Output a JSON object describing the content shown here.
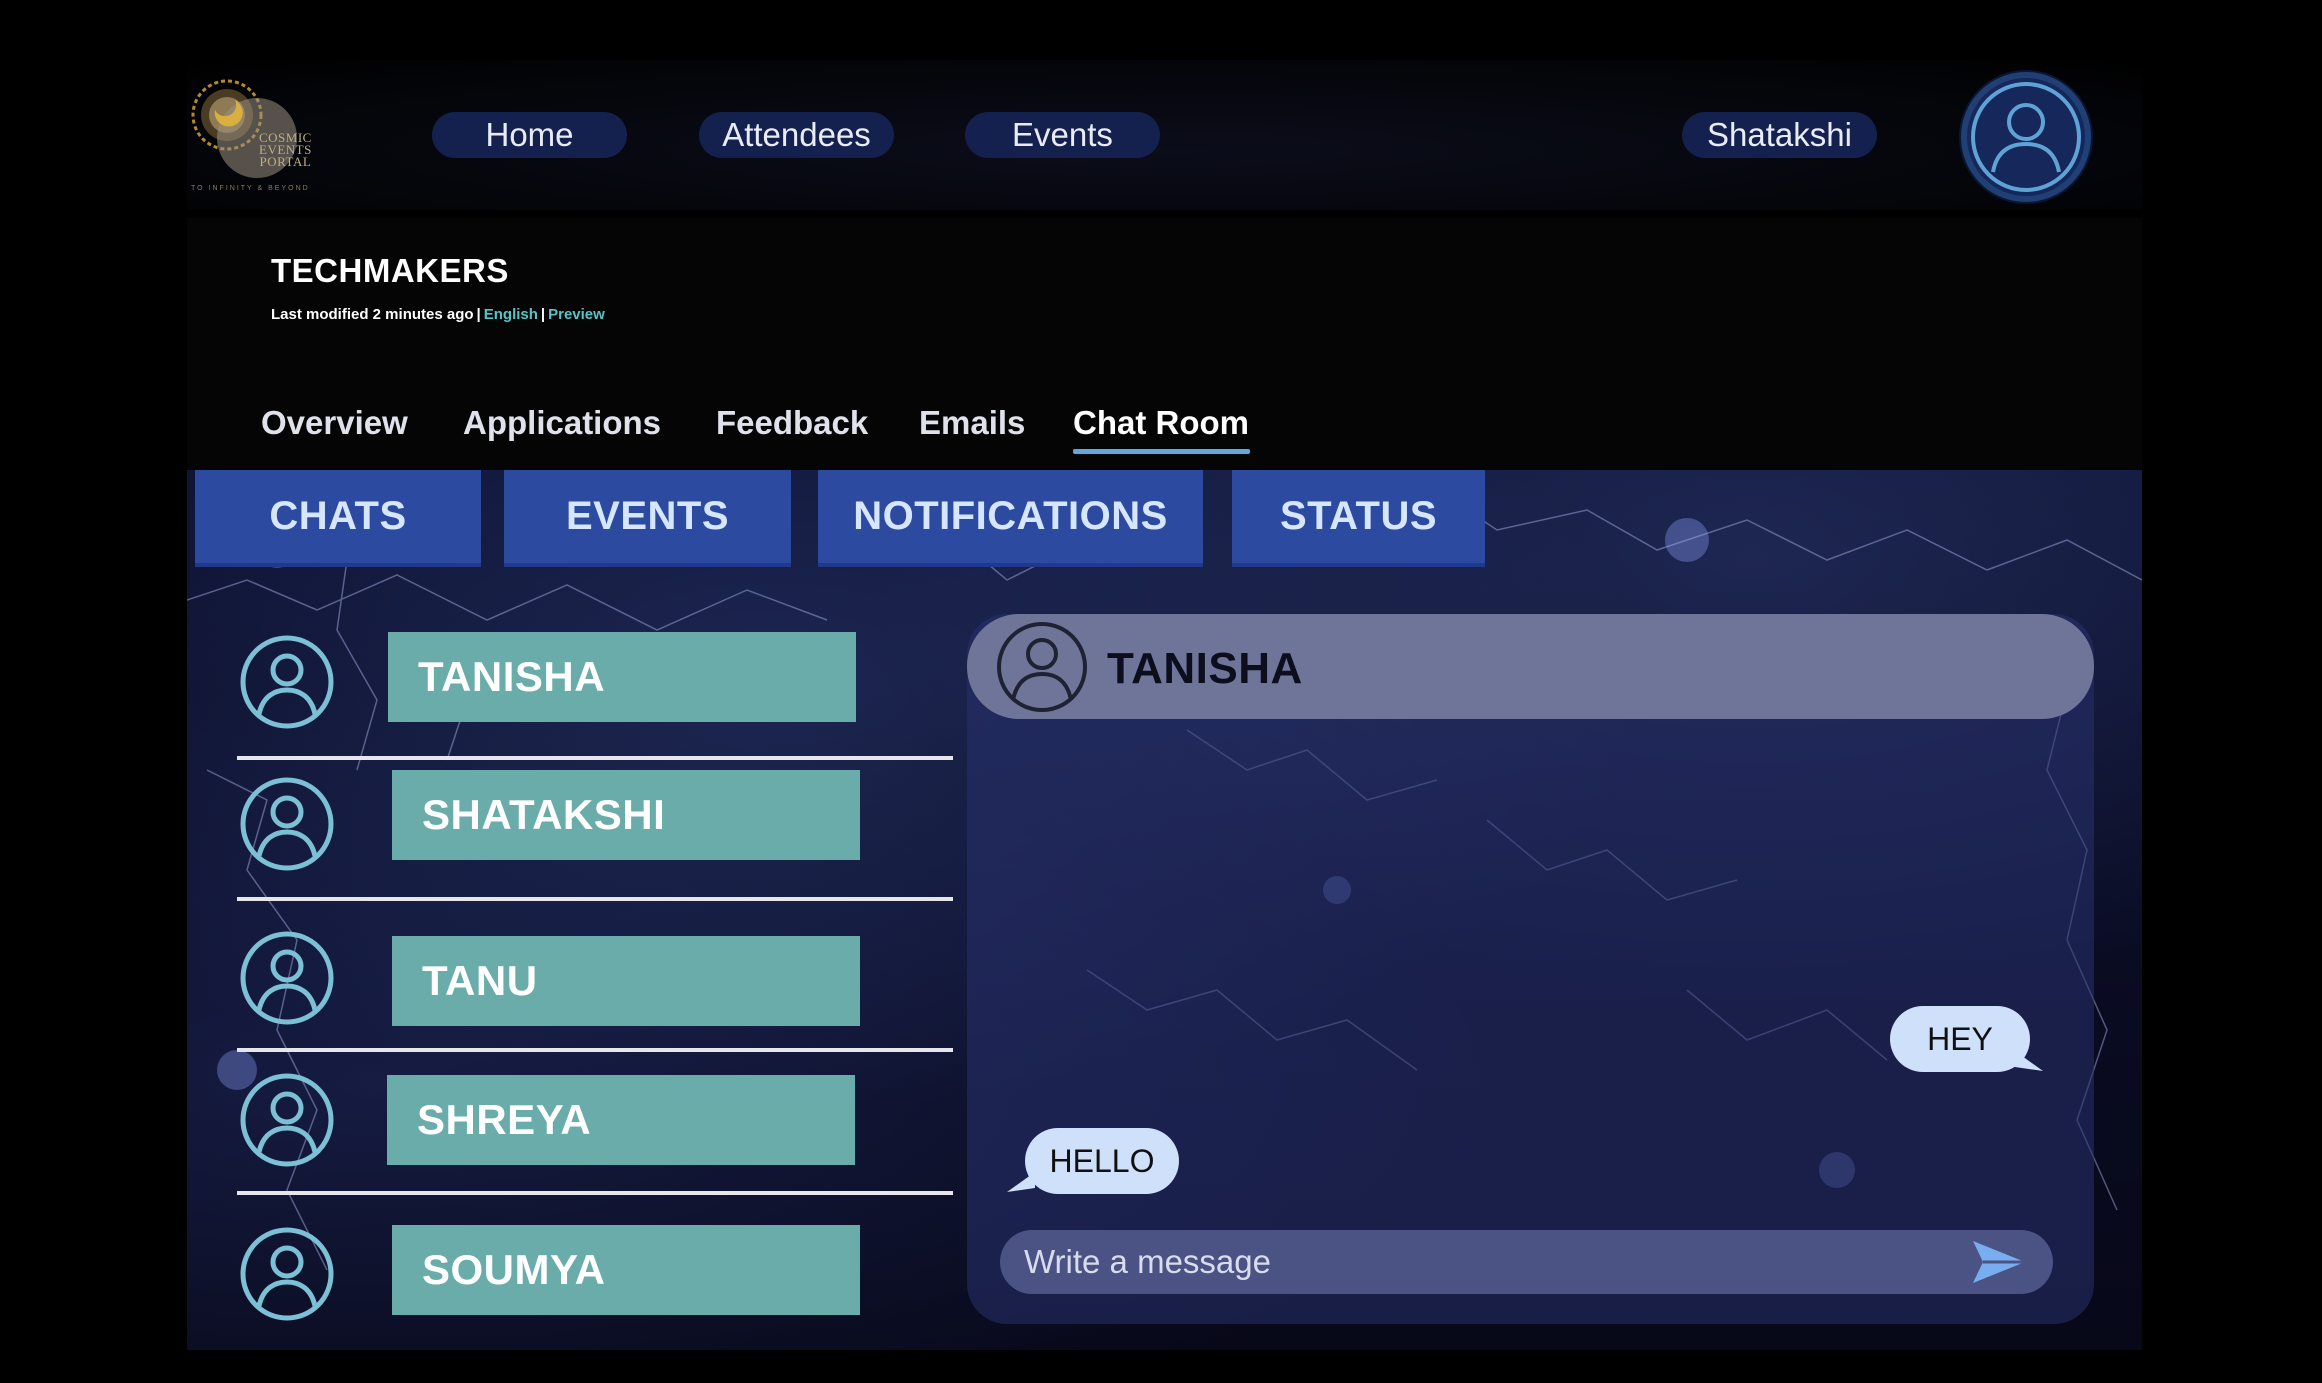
{
  "brand": {
    "logo_text": [
      "COSMIC",
      "EVENTS",
      "PORTAL"
    ],
    "tagline": "TO INFINITY & BEYOND"
  },
  "nav": {
    "items": [
      {
        "label": "Home"
      },
      {
        "label": "Attendees"
      },
      {
        "label": "Events"
      }
    ],
    "user_name": "Shatakshi",
    "profile_icon": "user-avatar-icon"
  },
  "project": {
    "title": "TECHMAKERS",
    "meta": "Last modified 2 minutes ago",
    "language_link": "English",
    "preview_link": "Preview"
  },
  "tabs": [
    {
      "label": "Overview"
    },
    {
      "label": "Applications"
    },
    {
      "label": "Feedback"
    },
    {
      "label": "Emails"
    },
    {
      "label": "Chat Room",
      "active": true
    }
  ],
  "subtabs": [
    {
      "label": "CHATS"
    },
    {
      "label": "EVENTS"
    },
    {
      "label": "NOTIFICATIONS"
    },
    {
      "label": "STATUS"
    }
  ],
  "chats": [
    {
      "name": "TANISHA"
    },
    {
      "name": "SHATAKSHI"
    },
    {
      "name": "TANU"
    },
    {
      "name": "SHREYA"
    },
    {
      "name": "SOUMYA"
    }
  ],
  "conversation": {
    "contact": "TANISHA",
    "messages": [
      {
        "text": "HEY",
        "side": "right"
      },
      {
        "text": "HELLO",
        "side": "left"
      }
    ],
    "input_placeholder": "Write a message",
    "send_icon": "send-arrow-icon"
  },
  "colors": {
    "nav_pill": "#14214f",
    "subtab": "#2c4aa0",
    "chat_name_bg": "#6aaca9",
    "avatar_stroke": "#7cc0d6",
    "accent_link": "#55c6c7",
    "bubble": "#cfe0fb"
  }
}
